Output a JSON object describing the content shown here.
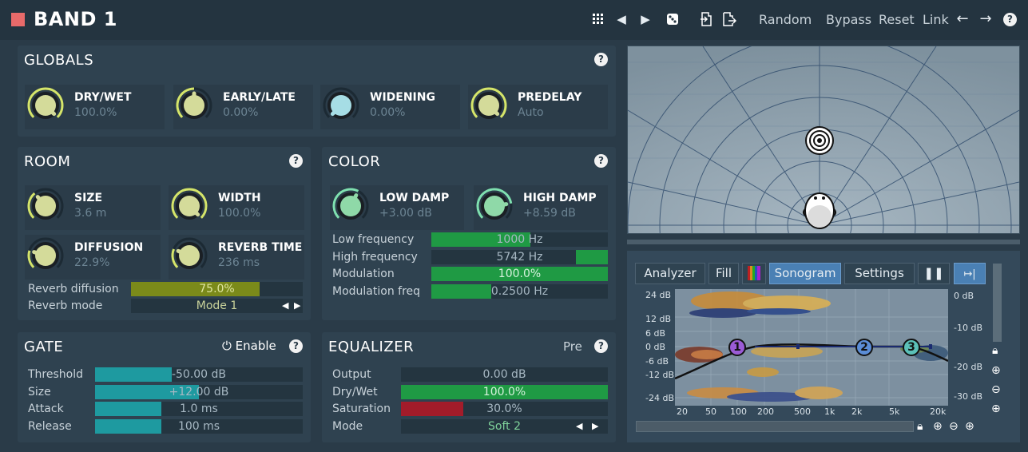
{
  "header": {
    "title": "BAND 1",
    "random": "Random",
    "bypass": "Bypass",
    "reset": "Reset",
    "link": "Link",
    "accent": "#e86a6a"
  },
  "globals": {
    "title": "GLOBALS",
    "help": "?",
    "knobs": [
      {
        "name": "DRY/WET",
        "value": "100.0%",
        "level": 1.0
      },
      {
        "name": "EARLY/LATE",
        "value": "0.00%",
        "level": 0.5
      },
      {
        "name": "WIDENING",
        "value": "0.00%",
        "level": 0.0
      },
      {
        "name": "PREDELAY",
        "value": "Auto",
        "level": 1.0
      }
    ]
  },
  "room": {
    "title": "ROOM",
    "help": "?",
    "knobs": [
      {
        "name": "SIZE",
        "value": "3.6 m",
        "level": 0.35
      },
      {
        "name": "WIDTH",
        "value": "100.0%",
        "level": 1.0
      },
      {
        "name": "DIFFUSION",
        "value": "22.9%",
        "level": 0.23
      },
      {
        "name": "REVERB TIME",
        "value": "236 ms",
        "level": 0.25
      }
    ],
    "reverb_diffusion": {
      "label": "Reverb diffusion",
      "value": "75.0%",
      "fraction": 0.75
    },
    "reverb_mode": {
      "label": "Reverb mode",
      "value": "Mode 1"
    }
  },
  "color": {
    "title": "COLOR",
    "help": "?",
    "knobs": [
      {
        "name": "LOW DAMP",
        "value": "+3.00 dB",
        "level": 0.6
      },
      {
        "name": "HIGH DAMP",
        "value": "+8.59 dB",
        "level": 0.8
      }
    ],
    "sliders": [
      {
        "label": "Low frequency",
        "value": "1000 Hz",
        "fraction": 0.56
      },
      {
        "label": "High frequency",
        "value": "5742 Hz",
        "fraction": 0.0
      },
      {
        "label": "Modulation",
        "value": "100.0%",
        "fraction": 1.0
      },
      {
        "label": "Modulation freq",
        "value": "0.2500 Hz",
        "fraction": 0.34
      }
    ]
  },
  "gate": {
    "title": "GATE",
    "enable": "Enable",
    "help": "?",
    "sliders": [
      {
        "label": "Threshold",
        "value": "-50.00 dB",
        "fraction": 0.37
      },
      {
        "label": "Size",
        "value": "+12.00 dB",
        "fraction": 0.5
      },
      {
        "label": "Attack",
        "value": "1.0 ms",
        "fraction": 0.32
      },
      {
        "label": "Release",
        "value": "100 ms",
        "fraction": 0.32
      }
    ]
  },
  "equalizer": {
    "title": "EQUALIZER",
    "pre": "Pre",
    "help": "?",
    "sliders": [
      {
        "label": "Output",
        "value": "0.00 dB",
        "fraction": 0.0
      },
      {
        "label": "Dry/Wet",
        "value": "100.0%",
        "fraction": 1.0
      },
      {
        "label": "Saturation",
        "value": "30.0%",
        "fraction": 0.3
      }
    ],
    "mode": {
      "label": "Mode",
      "value": "Soft 2"
    }
  },
  "analyzer": {
    "buttons": {
      "analyzer": "Analyzer",
      "fill": "Fill",
      "sonogram": "Sonogram",
      "settings": "Settings"
    },
    "db_left": [
      "24 dB",
      "12 dB",
      "6 dB",
      "0 dB",
      "-6 dB",
      "-12 dB",
      "-24 dB"
    ],
    "db_right": [
      "0 dB",
      "-10 dB",
      "-20 dB",
      "-30 dB"
    ],
    "freq_labels": [
      "20",
      "50",
      "100",
      "200",
      "500",
      "1k",
      "2k",
      "5k",
      "20k"
    ],
    "eq_bands": [
      "1",
      "2",
      "3"
    ]
  },
  "colors": {
    "knob_arc": "#d5e56a",
    "knob_arc_color": "#7fe0b0",
    "bar_green": "#1f9a44",
    "bar_teal": "#1e9aa0",
    "bar_olive": "#7b8a1a",
    "bar_red": "#a21c2a",
    "accent_blue": "#4a80b4"
  }
}
